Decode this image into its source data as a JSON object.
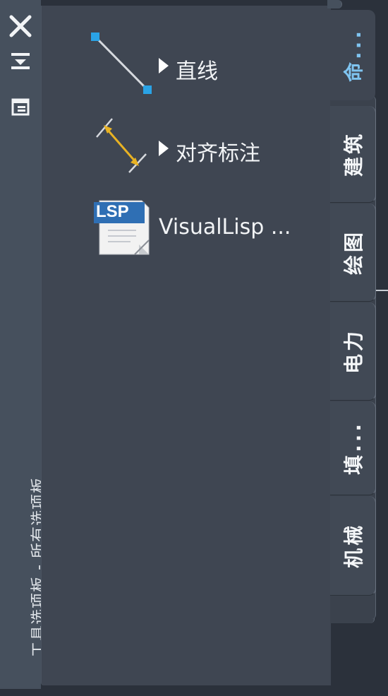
{
  "window": {
    "title": "工具选项板 - 所有选项板"
  },
  "title_buttons": [
    {
      "name": "close",
      "icon": "close-icon"
    },
    {
      "name": "auto-hide",
      "icon": "auto-hide-icon"
    },
    {
      "name": "properties",
      "icon": "properties-icon"
    }
  ],
  "tools": [
    {
      "label": "直线",
      "icon": "line-tool-icon",
      "has_flyout": true
    },
    {
      "label": "对齐标注",
      "icon": "aligned-dimension-icon",
      "has_flyout": true
    },
    {
      "label": "VisualLisp ...",
      "icon": "lsp-file-icon",
      "icon_text": "LSP",
      "has_flyout": false
    }
  ],
  "tabs": {
    "active": "命...",
    "items": [
      "建筑",
      "绘图",
      "电力",
      "填...",
      "机械"
    ]
  },
  "colors": {
    "title_strip": "#46505d",
    "palette_bg": "#3f4652",
    "accent_blue": "#2aa3e6",
    "dimension_yellow": "#e8b223",
    "text": "#f2f4f6"
  }
}
